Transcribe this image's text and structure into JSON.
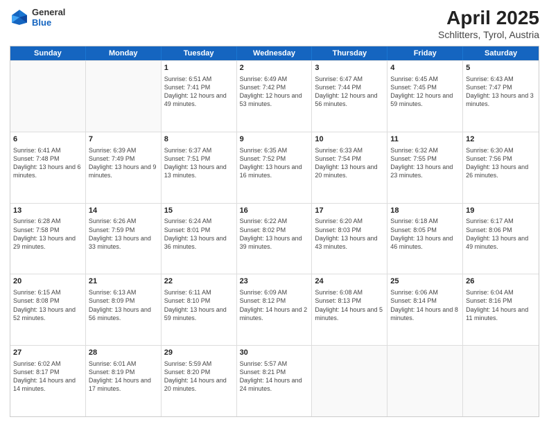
{
  "header": {
    "logo": {
      "general": "General",
      "blue": "Blue"
    },
    "title": "April 2025",
    "location": "Schlitters, Tyrol, Austria"
  },
  "weekdays": [
    "Sunday",
    "Monday",
    "Tuesday",
    "Wednesday",
    "Thursday",
    "Friday",
    "Saturday"
  ],
  "weeks": [
    [
      {
        "day": "",
        "sunrise": "",
        "sunset": "",
        "daylight": ""
      },
      {
        "day": "",
        "sunrise": "",
        "sunset": "",
        "daylight": ""
      },
      {
        "day": "1",
        "sunrise": "Sunrise: 6:51 AM",
        "sunset": "Sunset: 7:41 PM",
        "daylight": "Daylight: 12 hours and 49 minutes."
      },
      {
        "day": "2",
        "sunrise": "Sunrise: 6:49 AM",
        "sunset": "Sunset: 7:42 PM",
        "daylight": "Daylight: 12 hours and 53 minutes."
      },
      {
        "day": "3",
        "sunrise": "Sunrise: 6:47 AM",
        "sunset": "Sunset: 7:44 PM",
        "daylight": "Daylight: 12 hours and 56 minutes."
      },
      {
        "day": "4",
        "sunrise": "Sunrise: 6:45 AM",
        "sunset": "Sunset: 7:45 PM",
        "daylight": "Daylight: 12 hours and 59 minutes."
      },
      {
        "day": "5",
        "sunrise": "Sunrise: 6:43 AM",
        "sunset": "Sunset: 7:47 PM",
        "daylight": "Daylight: 13 hours and 3 minutes."
      }
    ],
    [
      {
        "day": "6",
        "sunrise": "Sunrise: 6:41 AM",
        "sunset": "Sunset: 7:48 PM",
        "daylight": "Daylight: 13 hours and 6 minutes."
      },
      {
        "day": "7",
        "sunrise": "Sunrise: 6:39 AM",
        "sunset": "Sunset: 7:49 PM",
        "daylight": "Daylight: 13 hours and 9 minutes."
      },
      {
        "day": "8",
        "sunrise": "Sunrise: 6:37 AM",
        "sunset": "Sunset: 7:51 PM",
        "daylight": "Daylight: 13 hours and 13 minutes."
      },
      {
        "day": "9",
        "sunrise": "Sunrise: 6:35 AM",
        "sunset": "Sunset: 7:52 PM",
        "daylight": "Daylight: 13 hours and 16 minutes."
      },
      {
        "day": "10",
        "sunrise": "Sunrise: 6:33 AM",
        "sunset": "Sunset: 7:54 PM",
        "daylight": "Daylight: 13 hours and 20 minutes."
      },
      {
        "day": "11",
        "sunrise": "Sunrise: 6:32 AM",
        "sunset": "Sunset: 7:55 PM",
        "daylight": "Daylight: 13 hours and 23 minutes."
      },
      {
        "day": "12",
        "sunrise": "Sunrise: 6:30 AM",
        "sunset": "Sunset: 7:56 PM",
        "daylight": "Daylight: 13 hours and 26 minutes."
      }
    ],
    [
      {
        "day": "13",
        "sunrise": "Sunrise: 6:28 AM",
        "sunset": "Sunset: 7:58 PM",
        "daylight": "Daylight: 13 hours and 29 minutes."
      },
      {
        "day": "14",
        "sunrise": "Sunrise: 6:26 AM",
        "sunset": "Sunset: 7:59 PM",
        "daylight": "Daylight: 13 hours and 33 minutes."
      },
      {
        "day": "15",
        "sunrise": "Sunrise: 6:24 AM",
        "sunset": "Sunset: 8:01 PM",
        "daylight": "Daylight: 13 hours and 36 minutes."
      },
      {
        "day": "16",
        "sunrise": "Sunrise: 6:22 AM",
        "sunset": "Sunset: 8:02 PM",
        "daylight": "Daylight: 13 hours and 39 minutes."
      },
      {
        "day": "17",
        "sunrise": "Sunrise: 6:20 AM",
        "sunset": "Sunset: 8:03 PM",
        "daylight": "Daylight: 13 hours and 43 minutes."
      },
      {
        "day": "18",
        "sunrise": "Sunrise: 6:18 AM",
        "sunset": "Sunset: 8:05 PM",
        "daylight": "Daylight: 13 hours and 46 minutes."
      },
      {
        "day": "19",
        "sunrise": "Sunrise: 6:17 AM",
        "sunset": "Sunset: 8:06 PM",
        "daylight": "Daylight: 13 hours and 49 minutes."
      }
    ],
    [
      {
        "day": "20",
        "sunrise": "Sunrise: 6:15 AM",
        "sunset": "Sunset: 8:08 PM",
        "daylight": "Daylight: 13 hours and 52 minutes."
      },
      {
        "day": "21",
        "sunrise": "Sunrise: 6:13 AM",
        "sunset": "Sunset: 8:09 PM",
        "daylight": "Daylight: 13 hours and 56 minutes."
      },
      {
        "day": "22",
        "sunrise": "Sunrise: 6:11 AM",
        "sunset": "Sunset: 8:10 PM",
        "daylight": "Daylight: 13 hours and 59 minutes."
      },
      {
        "day": "23",
        "sunrise": "Sunrise: 6:09 AM",
        "sunset": "Sunset: 8:12 PM",
        "daylight": "Daylight: 14 hours and 2 minutes."
      },
      {
        "day": "24",
        "sunrise": "Sunrise: 6:08 AM",
        "sunset": "Sunset: 8:13 PM",
        "daylight": "Daylight: 14 hours and 5 minutes."
      },
      {
        "day": "25",
        "sunrise": "Sunrise: 6:06 AM",
        "sunset": "Sunset: 8:14 PM",
        "daylight": "Daylight: 14 hours and 8 minutes."
      },
      {
        "day": "26",
        "sunrise": "Sunrise: 6:04 AM",
        "sunset": "Sunset: 8:16 PM",
        "daylight": "Daylight: 14 hours and 11 minutes."
      }
    ],
    [
      {
        "day": "27",
        "sunrise": "Sunrise: 6:02 AM",
        "sunset": "Sunset: 8:17 PM",
        "daylight": "Daylight: 14 hours and 14 minutes."
      },
      {
        "day": "28",
        "sunrise": "Sunrise: 6:01 AM",
        "sunset": "Sunset: 8:19 PM",
        "daylight": "Daylight: 14 hours and 17 minutes."
      },
      {
        "day": "29",
        "sunrise": "Sunrise: 5:59 AM",
        "sunset": "Sunset: 8:20 PM",
        "daylight": "Daylight: 14 hours and 20 minutes."
      },
      {
        "day": "30",
        "sunrise": "Sunrise: 5:57 AM",
        "sunset": "Sunset: 8:21 PM",
        "daylight": "Daylight: 14 hours and 24 minutes."
      },
      {
        "day": "",
        "sunrise": "",
        "sunset": "",
        "daylight": ""
      },
      {
        "day": "",
        "sunrise": "",
        "sunset": "",
        "daylight": ""
      },
      {
        "day": "",
        "sunrise": "",
        "sunset": "",
        "daylight": ""
      }
    ]
  ]
}
